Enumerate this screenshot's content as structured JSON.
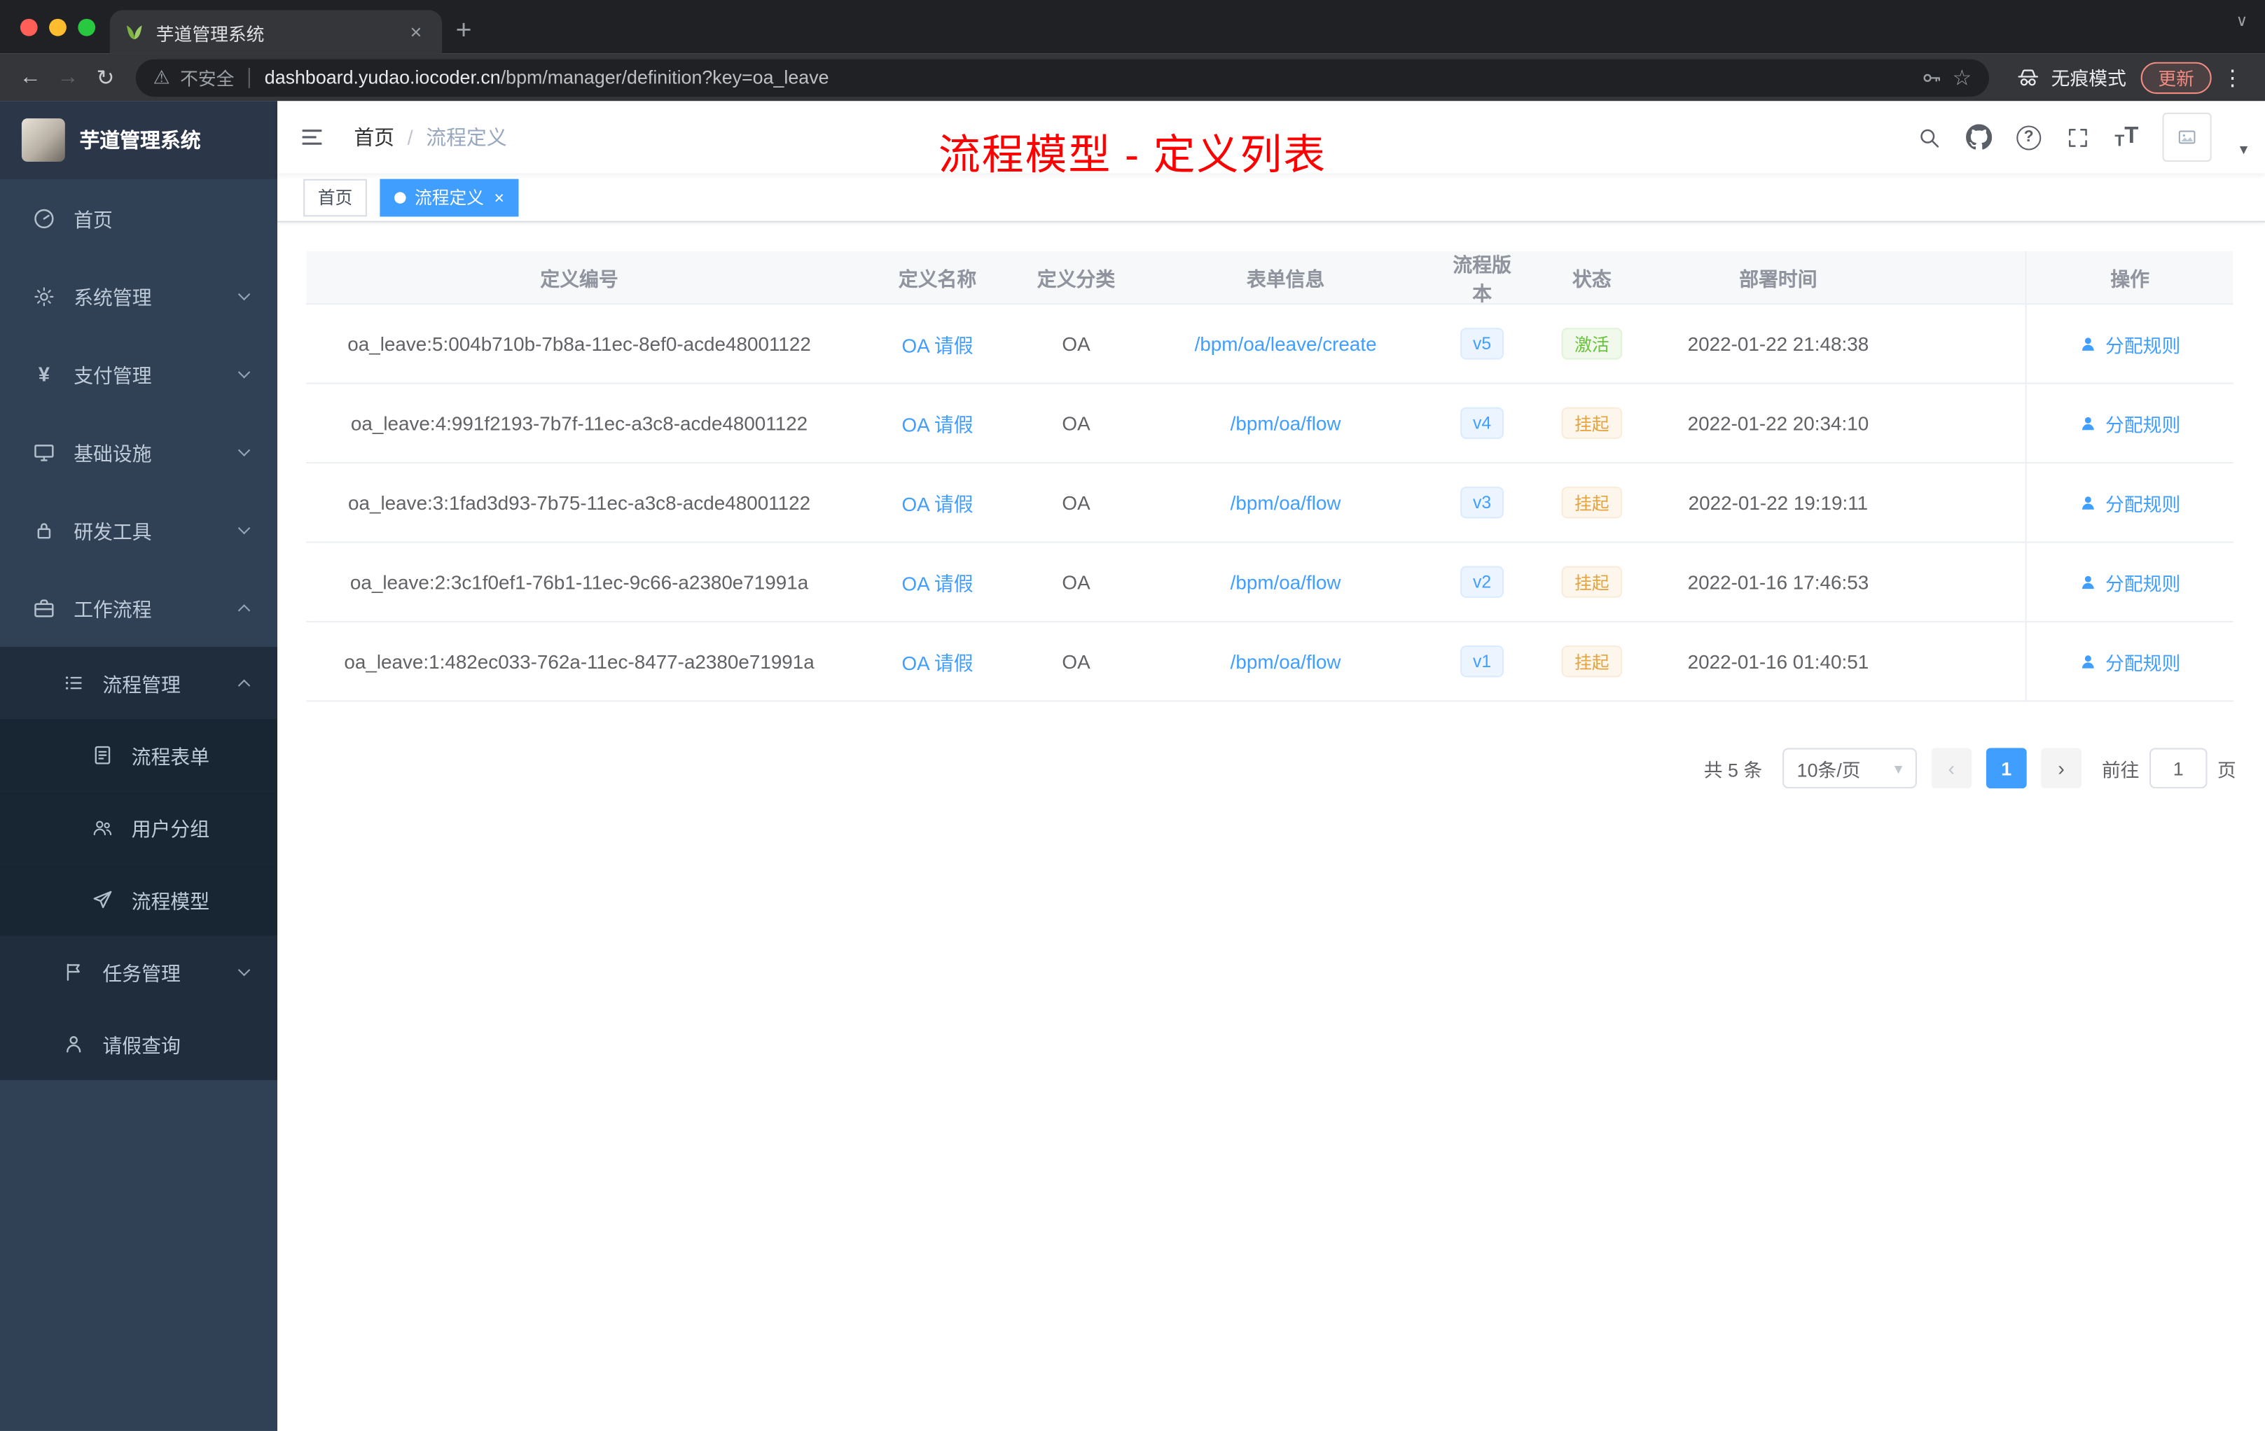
{
  "colors": {
    "accent": "#409eff",
    "annotation_red": "#ff0000",
    "status_active_green": "#67c23a",
    "status_suspended_orange": "#e6a23c",
    "sidebar_bg": "#304156",
    "sidebar_submenu_bg": "#1f2d3d"
  },
  "browser": {
    "tab_title": "芋道管理系统",
    "security_label": "不安全",
    "url_domain": "dashboard.yudao.iocoder.cn",
    "url_path": "/bpm/manager/definition?key=oa_leave",
    "incognito_label": "无痕模式",
    "update_label": "更新"
  },
  "icons": {
    "back-icon": "←",
    "forward-icon": "→",
    "reload-icon": "↻",
    "warning-icon": "⚠",
    "star-icon": "☆",
    "kebab-menu-icon": "⋮",
    "new-tab-icon": "+",
    "tab-close-icon": "×",
    "window-chevron-icon": "∨",
    "yen-icon": "¥",
    "question-icon": "?",
    "text-size-icon": "T",
    "prev-page-icon": "‹",
    "next-page-icon": "›",
    "select-caret-icon": "▾",
    "avatar-caret-icon": "▾"
  },
  "sidebar": {
    "logo_title": "芋道管理系统",
    "items": [
      {
        "label": "首页",
        "icon": "dashboard-icon"
      },
      {
        "label": "系统管理",
        "icon": "gear-icon"
      },
      {
        "label": "支付管理",
        "icon": "yen-icon"
      },
      {
        "label": "基础设施",
        "icon": "monitor-icon"
      },
      {
        "label": "研发工具",
        "icon": "lock-icon"
      },
      {
        "label": "工作流程",
        "icon": "briefcase-icon"
      },
      {
        "label": "流程管理",
        "icon": "list-icon"
      },
      {
        "label": "流程表单",
        "icon": "form-icon"
      },
      {
        "label": "用户分组",
        "icon": "group-icon"
      },
      {
        "label": "流程模型",
        "icon": "paper-plane-icon"
      },
      {
        "label": "任务管理",
        "icon": "flag-icon"
      },
      {
        "label": "请假查询",
        "icon": "user-icon"
      }
    ]
  },
  "header": {
    "breadcrumb_home": "首页",
    "breadcrumb_separator": "/",
    "breadcrumb_current": "流程定义",
    "annotation": "流程模型 - 定义列表"
  },
  "tags": [
    {
      "label": "首页",
      "active": false
    },
    {
      "label": "流程定义",
      "active": true
    }
  ],
  "table": {
    "columns": [
      "定义编号",
      "定义名称",
      "定义分类",
      "表单信息",
      "流程版本",
      "状态",
      "部署时间",
      "操作"
    ],
    "rows": [
      {
        "id": "oa_leave:5:004b710b-7b8a-11ec-8ef0-acde48001122",
        "name": "OA 请假",
        "category": "OA",
        "form_url": "/bpm/oa/leave/create",
        "version": "v5",
        "status": "激活",
        "status_type": "success",
        "deploy_time": "2022-01-22 21:48:38",
        "action_label": "分配规则"
      },
      {
        "id": "oa_leave:4:991f2193-7b7f-11ec-a3c8-acde48001122",
        "name": "OA 请假",
        "category": "OA",
        "form_url": "/bpm/oa/flow",
        "version": "v4",
        "status": "挂起",
        "status_type": "warning",
        "deploy_time": "2022-01-22 20:34:10",
        "action_label": "分配规则"
      },
      {
        "id": "oa_leave:3:1fad3d93-7b75-11ec-a3c8-acde48001122",
        "name": "OA 请假",
        "category": "OA",
        "form_url": "/bpm/oa/flow",
        "version": "v3",
        "status": "挂起",
        "status_type": "warning",
        "deploy_time": "2022-01-22 19:19:11",
        "action_label": "分配规则"
      },
      {
        "id": "oa_leave:2:3c1f0ef1-76b1-11ec-9c66-a2380e71991a",
        "name": "OA 请假",
        "category": "OA",
        "form_url": "/bpm/oa/flow",
        "version": "v2",
        "status": "挂起",
        "status_type": "warning",
        "deploy_time": "2022-01-16 17:46:53",
        "action_label": "分配规则"
      },
      {
        "id": "oa_leave:1:482ec033-762a-11ec-8477-a2380e71991a",
        "name": "OA 请假",
        "category": "OA",
        "form_url": "/bpm/oa/flow",
        "version": "v1",
        "status": "挂起",
        "status_type": "warning",
        "deploy_time": "2022-01-16 01:40:51",
        "action_label": "分配规则"
      }
    ]
  },
  "pagination": {
    "total_label": "共 5 条",
    "page_size_label": "10条/页",
    "current_page": "1",
    "goto_label": "前往",
    "goto_value": "1",
    "page_unit_label": "页"
  }
}
